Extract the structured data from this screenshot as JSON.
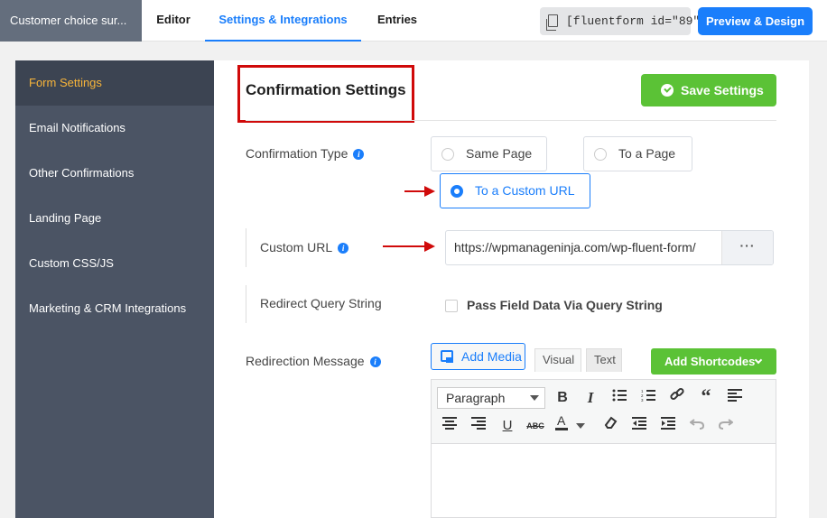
{
  "header": {
    "form_name": "Customer choice sur...",
    "tabs": [
      {
        "label": "Editor"
      },
      {
        "label": "Settings & Integrations"
      },
      {
        "label": "Entries"
      }
    ],
    "shortcode": "[fluentform id=\"89\"]",
    "preview_label": "Preview & Design"
  },
  "sidebar": {
    "items": [
      {
        "label": "Form Settings"
      },
      {
        "label": "Email Notifications"
      },
      {
        "label": "Other Confirmations"
      },
      {
        "label": "Landing Page"
      },
      {
        "label": "Custom CSS/JS"
      },
      {
        "label": "Marketing & CRM Integrations"
      }
    ]
  },
  "main": {
    "title": "Confirmation Settings",
    "save_label": "Save Settings",
    "confirmation_type": {
      "label": "Confirmation Type",
      "options": [
        "Same Page",
        "To a Page",
        "To a Custom URL"
      ],
      "selected": "To a Custom URL"
    },
    "custom_url": {
      "label": "Custom URL",
      "value": "https://wpmanageninja.com/wp-fluent-form/",
      "more_label": "···"
    },
    "redirect_query": {
      "label": "Redirect Query String",
      "checkbox_label": "Pass Field Data Via Query String"
    },
    "redirection_message": {
      "label": "Redirection Message",
      "add_media_label": "Add Media",
      "visual_tab": "Visual",
      "text_tab": "Text",
      "shortcodes_label": "Add Shortcodes",
      "format_value": "Paragraph"
    }
  },
  "colors": {
    "accent": "#1a7efb",
    "success": "#5bc236",
    "sidebar_bg": "#4b5464",
    "sidebar_active_text": "#f9b53a",
    "highlight_red": "#d00a0a"
  }
}
